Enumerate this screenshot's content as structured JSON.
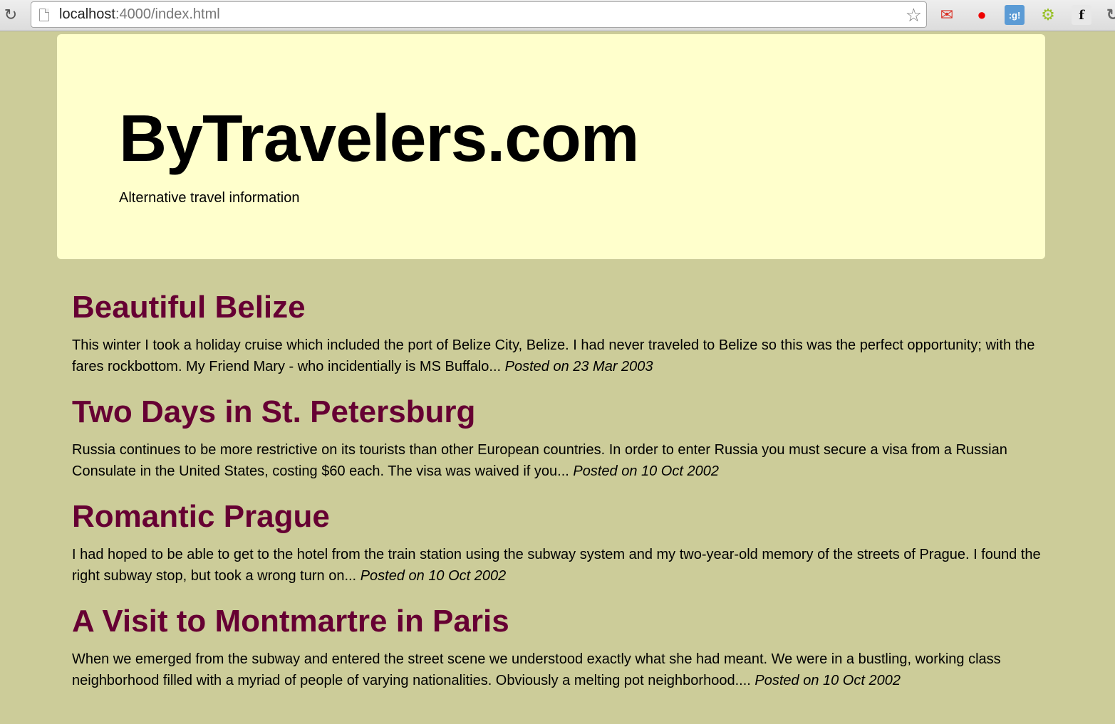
{
  "browser": {
    "url_host": "localhost",
    "url_path": ":4000/index.html",
    "reload_icon": "reload-icon",
    "bookmark_icon": "star-icon",
    "extensions": [
      "gmail-icon",
      "pin-icon",
      "google-icon",
      "android-icon",
      "font-icon",
      "more-icon"
    ],
    "google_ext_label": ":g!",
    "font_ext_label": "f"
  },
  "header": {
    "title": "ByTravelers.com",
    "tagline": "Alternative travel information",
    "background": "#ffffcc"
  },
  "page": {
    "background": "#cccc99",
    "title_color": "#660033"
  },
  "posts": [
    {
      "title": "Beautiful Belize",
      "excerpt": "This winter I took a holiday cruise which included the port of Belize City, Belize. I had never traveled to Belize so this was the perfect opportunity; with the fares rockbottom. My Friend Mary - who incidentially is MS Buffalo...",
      "date": "Posted on 23 Mar 2003"
    },
    {
      "title": "Two Days in St. Petersburg",
      "excerpt": "Russia continues to be more restrictive on its tourists than other European countries. In order to enter Russia you must secure a visa from a Russian Consulate in the United States, costing $60 each. The visa was waived if you...",
      "date": "Posted on 10 Oct 2002"
    },
    {
      "title": "Romantic Prague",
      "excerpt": "I had hoped to be able to get to the hotel from the train station using the subway system and my two-year-old memory of the streets of Prague. I found the right subway stop, but took a wrong turn on...",
      "date": "Posted on 10 Oct 2002"
    },
    {
      "title": "A Visit to Montmartre in Paris",
      "excerpt": "When we emerged from the subway and entered the street scene we understood exactly what she had meant. We were in a bustling, working class neighborhood filled with a myriad of people of varying nationalities. Obviously a melting pot neighborhood....",
      "date": "Posted on 10 Oct 2002"
    }
  ]
}
